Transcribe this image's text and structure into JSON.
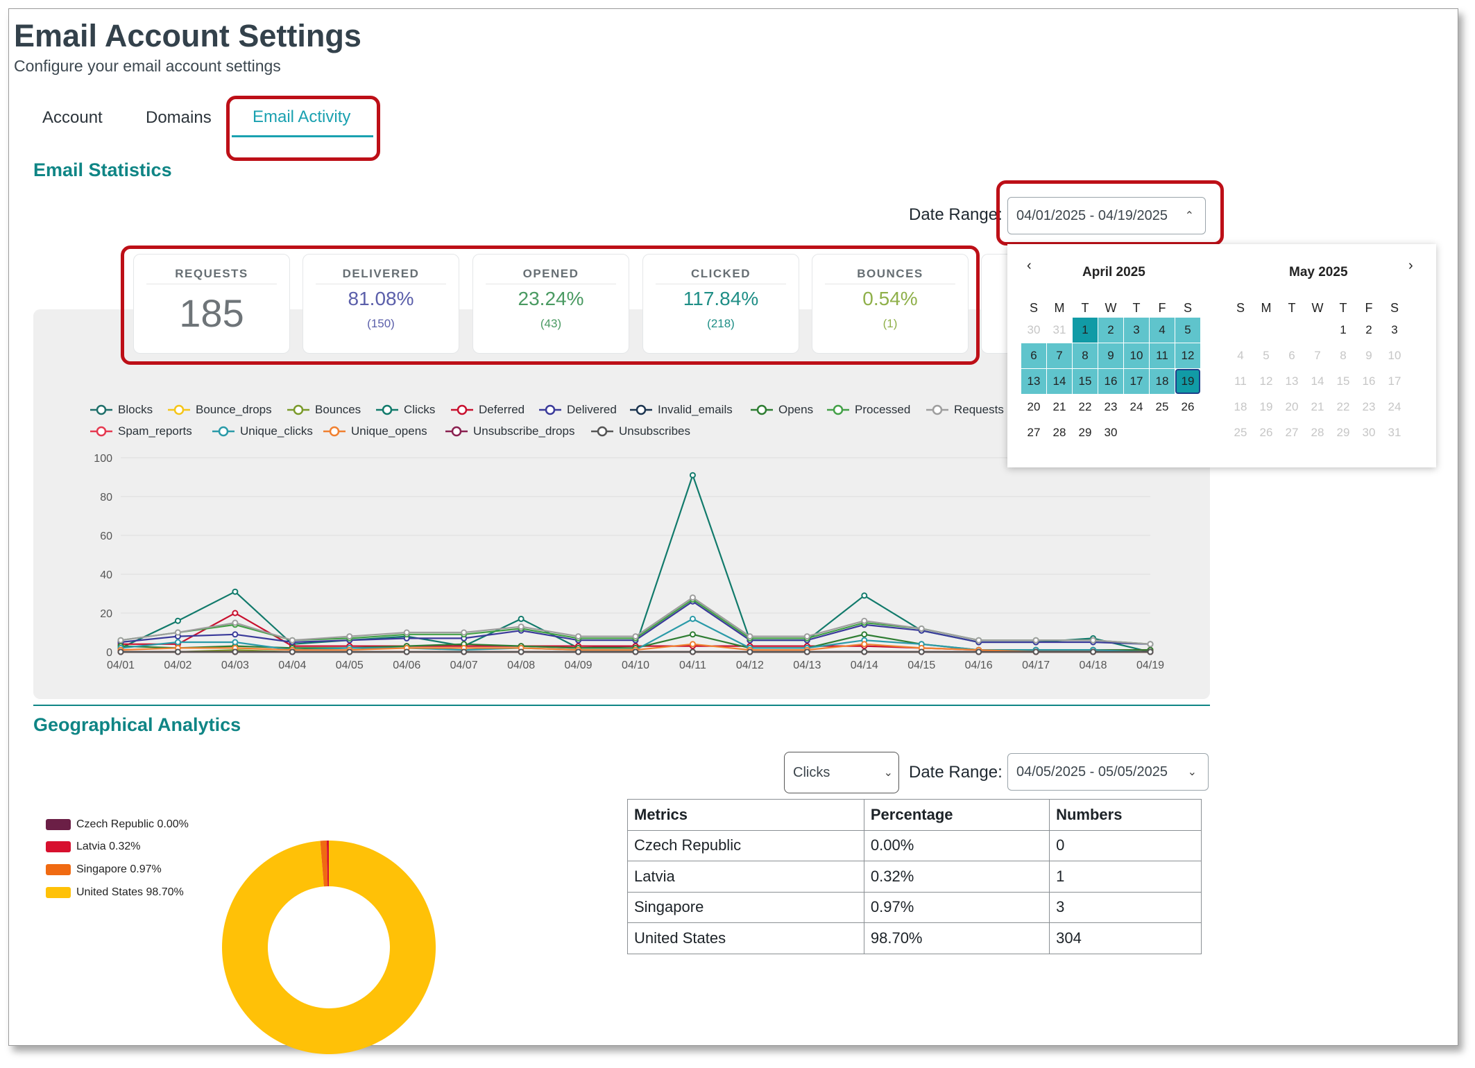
{
  "header": {
    "title": "Email Account Settings",
    "subtitle": "Configure your email account settings"
  },
  "tabs": [
    {
      "label": "Account"
    },
    {
      "label": "Domains"
    },
    {
      "label": "Email Activity"
    }
  ],
  "stats": {
    "title": "Email Statistics",
    "date_range_label": "Date Range:",
    "date_range_value": "04/01/2025 - 04/19/2025",
    "cards": [
      {
        "title": "REQUESTS",
        "value": "185",
        "sub": "",
        "color": "#6e7478"
      },
      {
        "title": "DELIVERED",
        "value": "81.08%",
        "sub": "(150)",
        "color": "#5b5faa"
      },
      {
        "title": "OPENED",
        "value": "23.24%",
        "sub": "(43)",
        "color": "#4a9a62"
      },
      {
        "title": "CLICKED",
        "value": "117.84%",
        "sub": "(218)",
        "color": "#1f8e86"
      },
      {
        "title": "BOUNCES",
        "value": "0.54%",
        "sub": "(1)",
        "color": "#8fb04a"
      }
    ]
  },
  "chart_data": {
    "type": "line",
    "x": [
      "04/01",
      "04/02",
      "04/03",
      "04/04",
      "04/05",
      "04/06",
      "04/07",
      "04/08",
      "04/09",
      "04/10",
      "04/11",
      "04/12",
      "04/13",
      "04/14",
      "04/15",
      "04/16",
      "04/17",
      "04/18",
      "04/19"
    ],
    "ylim": [
      0,
      100
    ],
    "yticks": [
      "0",
      "20",
      "40",
      "60",
      "80",
      "100"
    ],
    "series": [
      {
        "name": "Blocks",
        "color": "#1f6f6a",
        "values": [
          0,
          0,
          0,
          0,
          0,
          0,
          0,
          0,
          0,
          0,
          0,
          0,
          0,
          0,
          0,
          0,
          0,
          0,
          0
        ]
      },
      {
        "name": "Bounce_drops",
        "color": "#f5c518",
        "values": [
          0,
          0,
          0,
          0,
          0,
          0,
          0,
          0,
          0,
          0,
          0,
          0,
          0,
          0,
          0,
          0,
          0,
          0,
          0
        ]
      },
      {
        "name": "Bounces",
        "color": "#7a9a2a",
        "values": [
          0,
          0,
          1,
          0,
          0,
          0,
          0,
          0,
          0,
          0,
          0,
          0,
          0,
          0,
          0,
          0,
          0,
          0,
          0
        ]
      },
      {
        "name": "Clicks",
        "color": "#117a6b",
        "values": [
          2,
          16,
          31,
          4,
          6,
          8,
          3,
          17,
          2,
          3,
          91,
          6,
          6,
          29,
          11,
          5,
          5,
          7,
          0
        ]
      },
      {
        "name": "Deferred",
        "color": "#c8102e",
        "values": [
          4,
          4,
          20,
          3,
          3,
          3,
          3,
          3,
          3,
          3,
          3,
          3,
          3,
          3,
          2,
          1,
          1,
          1,
          1
        ]
      },
      {
        "name": "Delivered",
        "color": "#3a3a9a",
        "values": [
          5,
          8,
          9,
          5,
          6,
          7,
          7,
          11,
          6,
          6,
          26,
          6,
          6,
          14,
          11,
          5,
          5,
          5,
          4
        ]
      },
      {
        "name": "Invalid_emails",
        "color": "#1c3550",
        "values": [
          0,
          0,
          0,
          0,
          0,
          0,
          0,
          0,
          0,
          0,
          0,
          0,
          0,
          0,
          0,
          0,
          0,
          0,
          0
        ]
      },
      {
        "name": "Opens",
        "color": "#2e7d32",
        "values": [
          3,
          2,
          3,
          2,
          2,
          3,
          4,
          3,
          2,
          2,
          9,
          2,
          2,
          9,
          4,
          1,
          1,
          1,
          1
        ]
      },
      {
        "name": "Processed",
        "color": "#43a047",
        "values": [
          6,
          10,
          14,
          6,
          7,
          9,
          9,
          12,
          7,
          7,
          27,
          7,
          7,
          15,
          12,
          6,
          6,
          6,
          4
        ]
      },
      {
        "name": "Requests",
        "color": "#9e9e9e",
        "values": [
          6,
          10,
          15,
          6,
          8,
          10,
          10,
          13,
          8,
          8,
          28,
          8,
          8,
          16,
          12,
          6,
          6,
          6,
          4
        ]
      },
      {
        "name": "Spam_reports",
        "color": "#e53950",
        "values": [
          0,
          0,
          0,
          0,
          0,
          0,
          0,
          0,
          0,
          0,
          0,
          0,
          0,
          0,
          0,
          0,
          0,
          0,
          0
        ]
      },
      {
        "name": "Unique_clicks",
        "color": "#2a9aa8",
        "values": [
          2,
          5,
          5,
          1,
          2,
          2,
          1,
          2,
          1,
          1,
          17,
          2,
          2,
          6,
          4,
          1,
          1,
          1,
          0
        ]
      },
      {
        "name": "Unique_opens",
        "color": "#f08030",
        "values": [
          1,
          2,
          2,
          1,
          1,
          2,
          2,
          2,
          1,
          1,
          4,
          1,
          1,
          4,
          2,
          1,
          0,
          0,
          0
        ]
      },
      {
        "name": "Unsubscribe_drops",
        "color": "#8a2050",
        "values": [
          0,
          0,
          0,
          0,
          0,
          0,
          0,
          0,
          0,
          0,
          0,
          0,
          0,
          0,
          0,
          0,
          0,
          0,
          0
        ]
      },
      {
        "name": "Unsubscribes",
        "color": "#555555",
        "values": [
          0,
          0,
          0,
          0,
          0,
          0,
          0,
          0,
          0,
          0,
          0,
          0,
          0,
          0,
          0,
          0,
          0,
          0,
          0
        ]
      }
    ]
  },
  "calendar": {
    "prev_icon": "chevron-left-icon",
    "next_icon": "chevron-right-icon",
    "weekdays": [
      "S",
      "M",
      "T",
      "W",
      "T",
      "F",
      "S"
    ],
    "months": [
      {
        "name": "April 2025",
        "weeks": [
          [
            "30",
            "31",
            "1",
            "2",
            "3",
            "4",
            "5"
          ],
          [
            "6",
            "7",
            "8",
            "9",
            "10",
            "11",
            "12"
          ],
          [
            "13",
            "14",
            "15",
            "16",
            "17",
            "18",
            "19"
          ],
          [
            "20",
            "21",
            "22",
            "23",
            "24",
            "25",
            "26"
          ],
          [
            "27",
            "28",
            "29",
            "30",
            "",
            "",
            ""
          ]
        ]
      },
      {
        "name": "May 2025",
        "weeks": [
          [
            "",
            "",
            "",
            "",
            "1",
            "2",
            "3"
          ],
          [
            "4",
            "5",
            "6",
            "7",
            "8",
            "9",
            "10"
          ],
          [
            "11",
            "12",
            "13",
            "14",
            "15",
            "16",
            "17"
          ],
          [
            "18",
            "19",
            "20",
            "21",
            "22",
            "23",
            "24"
          ],
          [
            "25",
            "26",
            "27",
            "28",
            "29",
            "30",
            "31"
          ]
        ]
      }
    ],
    "range_color": "#5fc4cc",
    "edge_color": "#119ba6"
  },
  "geo": {
    "title": "Geographical Analytics",
    "metric_select": "Clicks",
    "date_range_label": "Date Range:",
    "date_range_value": "04/05/2025 - 05/05/2025",
    "legend": [
      {
        "label": "Czech Republic 0.00%",
        "color": "#6b1f46"
      },
      {
        "label": "Latvia 0.32%",
        "color": "#d7102e"
      },
      {
        "label": "Singapore 0.97%",
        "color": "#f06a12"
      },
      {
        "label": "United States 98.70%",
        "color": "#ffc107"
      }
    ],
    "donut": [
      {
        "name": "Czech Republic",
        "value": 0.0,
        "color": "#6b1f46"
      },
      {
        "name": "Latvia",
        "value": 0.32,
        "color": "#d7102e"
      },
      {
        "name": "Singapore",
        "value": 0.97,
        "color": "#f06a12"
      },
      {
        "name": "United States",
        "value": 98.7,
        "color": "#ffc107"
      }
    ],
    "table": {
      "headers": [
        "Metrics",
        "Percentage",
        "Numbers"
      ],
      "rows": [
        [
          "Czech Republic",
          "0.00%",
          "0"
        ],
        [
          "Latvia",
          "0.32%",
          "1"
        ],
        [
          "Singapore",
          "0.97%",
          "3"
        ],
        [
          "United States",
          "98.70%",
          "304"
        ]
      ]
    }
  }
}
